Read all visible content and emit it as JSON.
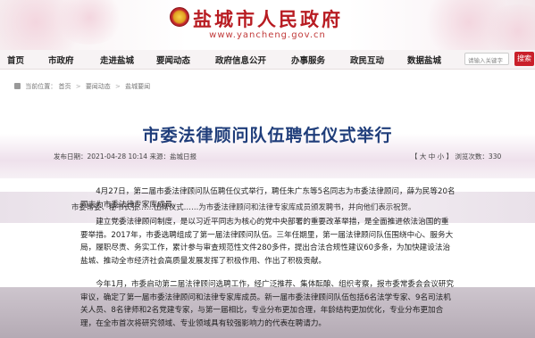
{
  "header": {
    "site_title": "盐城市人民政府",
    "site_url": "www.yancheng.gov.cn"
  },
  "nav": {
    "items": [
      "首页",
      "市政府",
      "走进盐城",
      "要闻动态",
      "政府信息公开",
      "办事服务",
      "政民互动",
      "数据盐城"
    ],
    "search_placeholder": "请输入关键字",
    "search_label": "搜索"
  },
  "breadcrumb": {
    "prefix": "当前位置：",
    "items": [
      "首页",
      "要闻动态",
      "盐城要闻"
    ],
    "separator": ">"
  },
  "article": {
    "title": "市委法律顾问队伍聘任仪式举行",
    "meta_left": "发布日期：2021-04-28 10:14   来源：盐城日报",
    "meta_right": "【 大  中  小 】  浏览次数：330",
    "lead_line": "市委常委、秘书长张……出席仪式……为市委法律顾问和法律专家库成员颁发聘书，并向他们表示祝贺。",
    "paragraphs": [
      "4月27日，第二届市委法律顾问队伍聘任仪式举行，聘任朱广东等5名同志为市委法律顾问，薛为民等20名同志为市委法律专家库成员。",
      "建立党委法律顾问制度，是以习近平同志为核心的党中央部署的重要改革举措，是全面推进依法治国的重要举措。2017年，市委选聘组成了第一届法律顾问队伍。三年任期里，第一届法律顾问队伍围绕中心、服务大局，履职尽责、务实工作，累计参与审查规范性文件280多件，提出合法合规性建议60多条，为加快建设法治盐城、推动全市经济社会高质量发展发挥了积极作用、作出了积极贡献。",
      "今年1月，市委启动第二届法律顾问选聘工作，经广泛推荐、集体酝酿、组织考察，报市委常委会会议研究审议，确定了第一届市委法律顾问和法律专家库成员。新一届市委法律顾问队伍包括6名法学专家、9名司法机关人员、8名律师和2名党建专家，与第一届相比，专业分布更加合理，年龄结构更加优化，专业分布更加合理，在全市首次将研究领域、专业领域具有较强影响力的代表在聘请力。"
    ]
  }
}
